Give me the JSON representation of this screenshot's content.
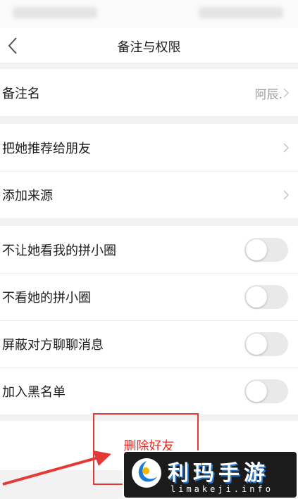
{
  "nav": {
    "title": "备注与权限"
  },
  "remark": {
    "label": "备注名",
    "value": "阿辰."
  },
  "links": [
    {
      "label": "把她推荐给朋友"
    },
    {
      "label": "添加来源"
    }
  ],
  "toggles": [
    {
      "label": "不让她看我的拼小圈",
      "on": false
    },
    {
      "label": "不看她的拼小圈",
      "on": false
    },
    {
      "label": "屏蔽对方聊聊消息",
      "on": false
    },
    {
      "label": "加入黑名单",
      "on": false
    }
  ],
  "delete_button": {
    "label": "删除好友"
  },
  "watermark": {
    "title": "利玛手游",
    "subtitle": "limakeji.info"
  },
  "colors": {
    "accent": "#e02e24",
    "highlight": "#e53935",
    "toggle_off": "#e9e9e9"
  }
}
